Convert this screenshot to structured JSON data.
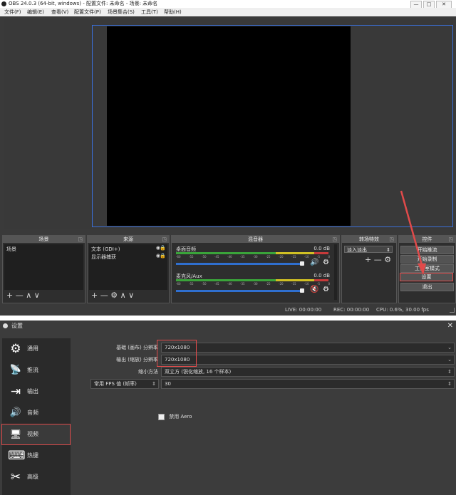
{
  "obs": {
    "title": "OBS 24.0.3 (64-bit, windows) - 配置文件: 未命名 - 场景: 未命名",
    "menu": [
      "文件(F)",
      "编辑(E)",
      "查看(V)",
      "配置文件(P)",
      "场景集合(S)",
      "工具(T)",
      "帮助(H)"
    ],
    "window_buttons": [
      "—",
      "□",
      "✕"
    ],
    "docks": {
      "scenes": {
        "title": "场景",
        "items": [
          "场景"
        ],
        "toolbar": [
          "+",
          "—",
          "∧",
          "∨"
        ]
      },
      "sources": {
        "title": "来源",
        "items": [
          "文本 (GDI+)",
          "显示器捕获"
        ],
        "toolbar": [
          "+",
          "—",
          "⚙",
          "∧",
          "∨"
        ]
      },
      "mixer": {
        "title": "混音器",
        "channels": [
          {
            "name": "桌面音频",
            "db": "0.0 dB",
            "ticks": [
              "-60",
              "-55",
              "-50",
              "-45",
              "-40",
              "-35",
              "-30",
              "-25",
              "-20",
              "-15",
              "-10",
              "-5",
              "0"
            ],
            "muted": false,
            "volume": 0.95
          },
          {
            "name": "麦克风/Aux",
            "db": "0.0 dB",
            "ticks": [
              "-60",
              "-55",
              "-50",
              "-45",
              "-40",
              "-35",
              "-30",
              "-25",
              "-20",
              "-15",
              "-10",
              "-5",
              "0"
            ],
            "muted": true,
            "volume": 0.95
          }
        ]
      },
      "transitions": {
        "title": "转场特效",
        "selected": "淡入淡出",
        "toolbar": [
          "+",
          "—",
          "⚙"
        ]
      },
      "controls": {
        "title": "控件",
        "buttons": [
          "开始推流",
          "开始录制",
          "工作室模式",
          "设置",
          "退出"
        ]
      }
    },
    "status": {
      "live": "LIVE: 00:00:00",
      "rec": "REC: 00:00:00",
      "cpu": "CPU: 0.6%, 30.00 fps"
    }
  },
  "settings": {
    "title": "设置",
    "nav": [
      {
        "label": "通用",
        "icon": "gear-icon",
        "glyph": "⚙"
      },
      {
        "label": "推流",
        "icon": "broadcast-icon",
        "glyph": "📡"
      },
      {
        "label": "输出",
        "icon": "output-icon",
        "glyph": "⇥"
      },
      {
        "label": "音频",
        "icon": "speaker-icon",
        "glyph": "🔊"
      },
      {
        "label": "视频",
        "icon": "monitor-icon",
        "glyph": "🖥"
      },
      {
        "label": "热键",
        "icon": "keyboard-icon",
        "glyph": "⌨"
      },
      {
        "label": "高级",
        "icon": "tools-icon",
        "glyph": "✂"
      }
    ],
    "active_nav": "视频",
    "fields": {
      "base_res_label": "基础 (画布) 分辨率",
      "base_res_value": "720x1080",
      "output_res_label": "输出 (缩放) 分辨率",
      "output_res_value": "720x1080",
      "downscale_label": "缩小方法",
      "downscale_value": "双立方 (锐化缩放, 16 个样本)",
      "fps_label": "常用 FPS 值 (帧率)",
      "fps_value": "30",
      "aero_label": "禁用 Aero"
    }
  },
  "annotation": {
    "color": "#e04a4a"
  }
}
